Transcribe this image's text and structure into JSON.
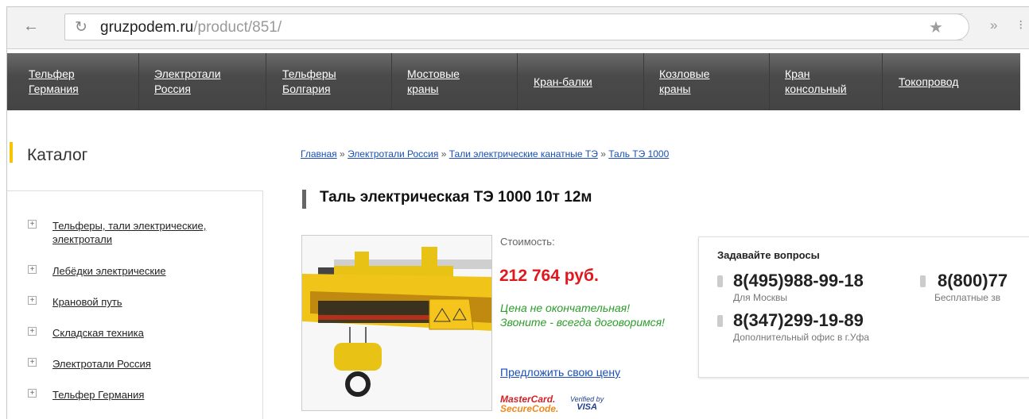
{
  "browser": {
    "url_domain": "gruzpodem.ru",
    "url_path": "/product/851/",
    "back_icon": "back-arrow",
    "reload_icon": "reload",
    "star_icon": "bookmark-star",
    "more_label": "»"
  },
  "nav": [
    {
      "line1": "Тельфер",
      "line2": "Германия"
    },
    {
      "line1": "Электротали",
      "line2": "Россия"
    },
    {
      "line1": "Тельферы",
      "line2": "Болгария"
    },
    {
      "line1": "Мостовые",
      "line2": "краны"
    },
    {
      "line1": "Кран-балки",
      "line2": ""
    },
    {
      "line1": "Козловые",
      "line2": "краны"
    },
    {
      "line1": "Кран",
      "line2": "консольный"
    },
    {
      "line1": "Токопровод",
      "line2": ""
    }
  ],
  "sidebar": {
    "title": "Каталог",
    "items": [
      {
        "label": "Тельферы, тали электрические, электротали"
      },
      {
        "label": "Лебёдки электрические"
      },
      {
        "label": "Крановой путь"
      },
      {
        "label": "Складская техника"
      },
      {
        "label": "Электротали Россия"
      },
      {
        "label": "Тельфер Германия"
      }
    ]
  },
  "breadcrumb": {
    "home": "Главная",
    "sep": "»",
    "level1": "Электротали Россия",
    "level2": "Тали электрические канатные ТЭ",
    "level3": "Таль ТЭ 1000"
  },
  "product": {
    "title": "Таль электрическая ТЭ 1000 10т 12м",
    "price_label": "Стоимость:",
    "price": "212 764 руб.",
    "note": "Цена не окончательная! Звоните - всегда договоримся!",
    "offer_link": "Предложить свою цену",
    "mastercard_line1": "MasterCard.",
    "mastercard_line2": "SecureCode.",
    "visa_line1": "Verified by",
    "visa_line2": "VISA"
  },
  "contacts": {
    "title": "Задавайте вопросы",
    "phones": [
      {
        "number": "8(495)988-99-18",
        "note": "Для Москвы"
      },
      {
        "number": "8(800)77",
        "note": "Бесплатные зв"
      },
      {
        "number": "8(347)299-19-89",
        "note": "Дополнительный офис в г.Уфа"
      }
    ]
  }
}
